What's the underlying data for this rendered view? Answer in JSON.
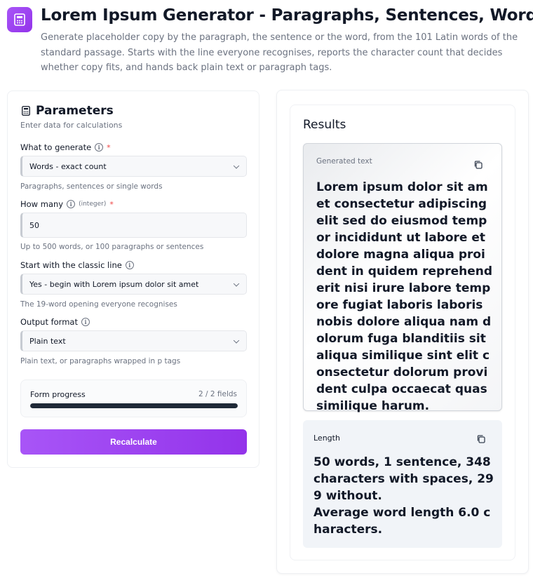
{
  "header": {
    "title": "Lorem Ipsum Generator - Paragraphs, Sentences, Words",
    "description": "Generate placeholder copy by the paragraph, the sentence or the word, from the 101 Latin words of the standard passage. Starts with the line everyone recognises, reports the character count that decides whether copy fits, and hands back plain text or paragraph tags.",
    "icon": "calculator-icon"
  },
  "parameters": {
    "title": "Parameters",
    "subtitle": "Enter data for calculations",
    "fields": {
      "what": {
        "label": "What to generate",
        "value": "Words - exact count",
        "help": "Paragraphs, sentences or single words",
        "required": "*"
      },
      "how_many": {
        "label": "How many",
        "qualifier": "(integer)",
        "value": "50",
        "help": "Up to 500 words, or 100 paragraphs or sentences",
        "required": "*"
      },
      "classic": {
        "label": "Start with the classic line",
        "value": "Yes - begin with Lorem ipsum dolor sit amet",
        "help": "The 19-word opening everyone recognises"
      },
      "format": {
        "label": "Output format",
        "value": "Plain text",
        "help": "Plain text, or paragraphs wrapped in p tags"
      }
    },
    "progress": {
      "label": "Form progress",
      "count": "2 / 2 fields",
      "fraction": 1.0
    },
    "recalculate_label": "Recalculate"
  },
  "results": {
    "title": "Results",
    "generated": {
      "label": "Generated text",
      "text": "Lorem ipsum dolor sit amet consectetur adipiscing elit sed do eiusmod tempor incididunt ut labore et dolore magna aliqua proident in quidem reprehenderit nisi irure labore tempore fugiat laboris laboris nobis dolore aliqua nam dolorum fuga blanditiis sit aliqua similique sint elit consectetur dolorum provident culpa occaecat quas similique harum."
    },
    "length": {
      "label": "Length",
      "line1": "50 words, 1 sentence, 348 characters with spaces, 299 without.",
      "line2": "Average word length 6.0 characters."
    }
  },
  "colors": {
    "accent": "#9333ea",
    "accent_light": "#a855f7",
    "progress": "#1f2937"
  }
}
